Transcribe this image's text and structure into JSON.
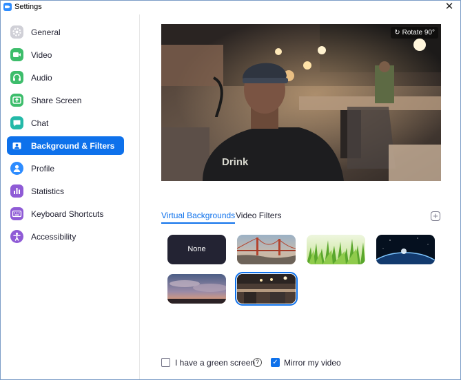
{
  "window": {
    "title": "Settings",
    "close_glyph": "✕"
  },
  "sidebar": {
    "items": [
      {
        "label": "General",
        "icon": "gear-icon",
        "color": "#d0d0d7",
        "active": false
      },
      {
        "label": "Video",
        "icon": "video-camera-icon",
        "color": "#3dbd6b",
        "active": false
      },
      {
        "label": "Audio",
        "icon": "headphones-icon",
        "color": "#3dbd6b",
        "active": false
      },
      {
        "label": "Share Screen",
        "icon": "share-screen-icon",
        "color": "#3dbd6b",
        "active": false
      },
      {
        "label": "Chat",
        "icon": "chat-bubble-icon",
        "color": "#24b9a8",
        "active": false
      },
      {
        "label": "Background & Filters",
        "icon": "background-portrait-icon",
        "color": "#2d8cff",
        "active": true
      },
      {
        "label": "Profile",
        "icon": "profile-icon",
        "color": "#2d8cff",
        "active": false
      },
      {
        "label": "Statistics",
        "icon": "statistics-icon",
        "color": "#8f5bd6",
        "active": false
      },
      {
        "label": "Keyboard Shortcuts",
        "icon": "keyboard-icon",
        "color": "#8f5bd6",
        "active": false
      },
      {
        "label": "Accessibility",
        "icon": "accessibility-icon",
        "color": "#8f5bd6",
        "active": false
      }
    ]
  },
  "preview": {
    "rotate_label": "Rotate 90°",
    "rotate_icon": "rotate-icon"
  },
  "tabs": {
    "virtual_backgrounds": "Virtual Backgrounds",
    "video_filters": "Video Filters",
    "active": "virtual_backgrounds"
  },
  "add_button": {
    "glyph": "+",
    "icon": "plus-icon"
  },
  "backgrounds": [
    {
      "label": "None",
      "type": "none",
      "selected": false
    },
    {
      "label": "",
      "type": "golden-gate-bridge",
      "selected": false
    },
    {
      "label": "",
      "type": "grass",
      "selected": false
    },
    {
      "label": "",
      "type": "earth-from-space",
      "selected": false
    },
    {
      "label": "",
      "type": "sunset-clouds",
      "selected": false
    },
    {
      "label": "",
      "type": "cafe-blurred",
      "selected": true
    }
  ],
  "footer": {
    "green_screen_label": "I have a green screen",
    "green_screen_checked": false,
    "help_glyph": "?",
    "mirror_label": "Mirror my video",
    "mirror_checked": true,
    "check_glyph": "✓"
  },
  "colors": {
    "accent": "#0e71eb",
    "sidebar_active_bg": "#0e71eb"
  }
}
